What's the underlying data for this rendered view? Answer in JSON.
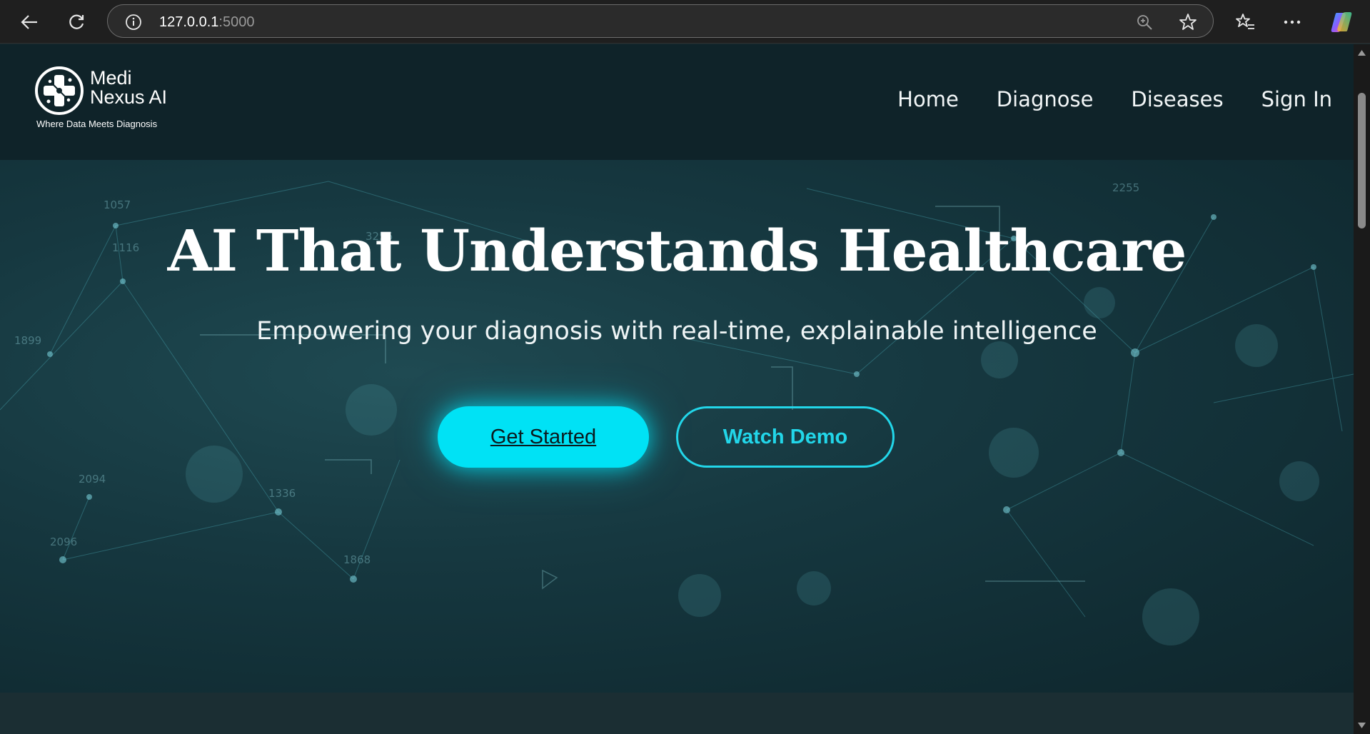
{
  "browser": {
    "url_host": "127.0.0.1",
    "url_port": ":5000",
    "icons": [
      "back-arrow-icon",
      "refresh-icon",
      "site-info-icon",
      "zoom-icon",
      "favorite-star-icon",
      "favorites-list-icon",
      "more-options-icon",
      "copilot-icon"
    ]
  },
  "navbar": {
    "logo_line1": "Medi",
    "logo_line2": "Nexus AI",
    "tagline": "Where Data Meets Diagnosis",
    "links": [
      "Home",
      "Diagnose",
      "Diseases",
      "Sign In"
    ]
  },
  "hero": {
    "title": "AI That Understands Healthcare",
    "subtitle": "Empowering your diagnosis with real-time, explainable intelligence",
    "primary_button": "Get Started",
    "secondary_button": "Watch Demo",
    "bg_numbers": [
      "1057",
      "1116",
      "1899",
      "3256",
      "2255",
      "1336",
      "2096",
      "1868",
      "2094"
    ]
  },
  "colors": {
    "accent": "#00e2f5",
    "navbar_bg": "#0f2329",
    "browser_bg": "#1f1f1f"
  }
}
